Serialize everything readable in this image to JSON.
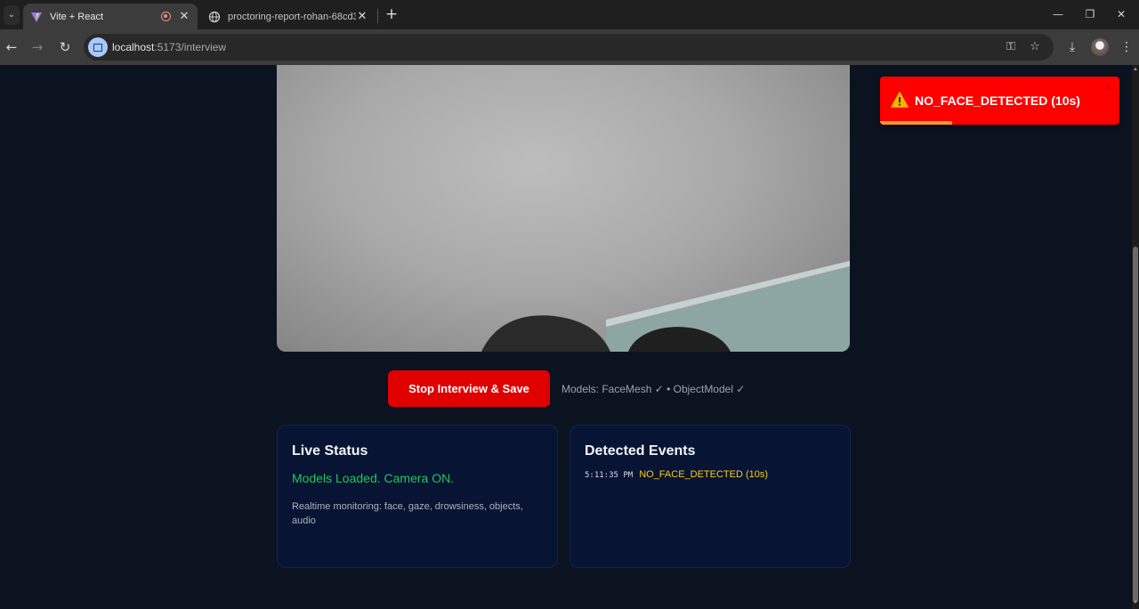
{
  "browser": {
    "tabs": [
      {
        "title": "Vite + React",
        "active": true,
        "recording": true
      },
      {
        "title": "proctoring-report-rohan-68cd3",
        "active": false
      }
    ],
    "url_host": "localhost",
    "url_rest": ":5173/interview"
  },
  "controls": {
    "stop_label": "Stop Interview & Save",
    "models_text": "Models: FaceMesh ✓ • ObjectModel ✓"
  },
  "live_status": {
    "title": "Live Status",
    "status": "Models Loaded. Camera ON.",
    "description": "Realtime monitoring: face, gaze, drowsiness, objects, audio"
  },
  "events": {
    "title": "Detected Events",
    "items": [
      {
        "time": "5:11:35 PM",
        "type": "NO_FACE_DETECTED (10s)"
      }
    ]
  },
  "toast": {
    "message": "NO_FACE_DETECTED (10s)",
    "close": "×",
    "progress": 0.3
  },
  "colors": {
    "page_bg": "#0b1220",
    "card_bg": "#071433",
    "danger": "#e00000",
    "success": "#22c55e",
    "warning": "#facc15"
  }
}
